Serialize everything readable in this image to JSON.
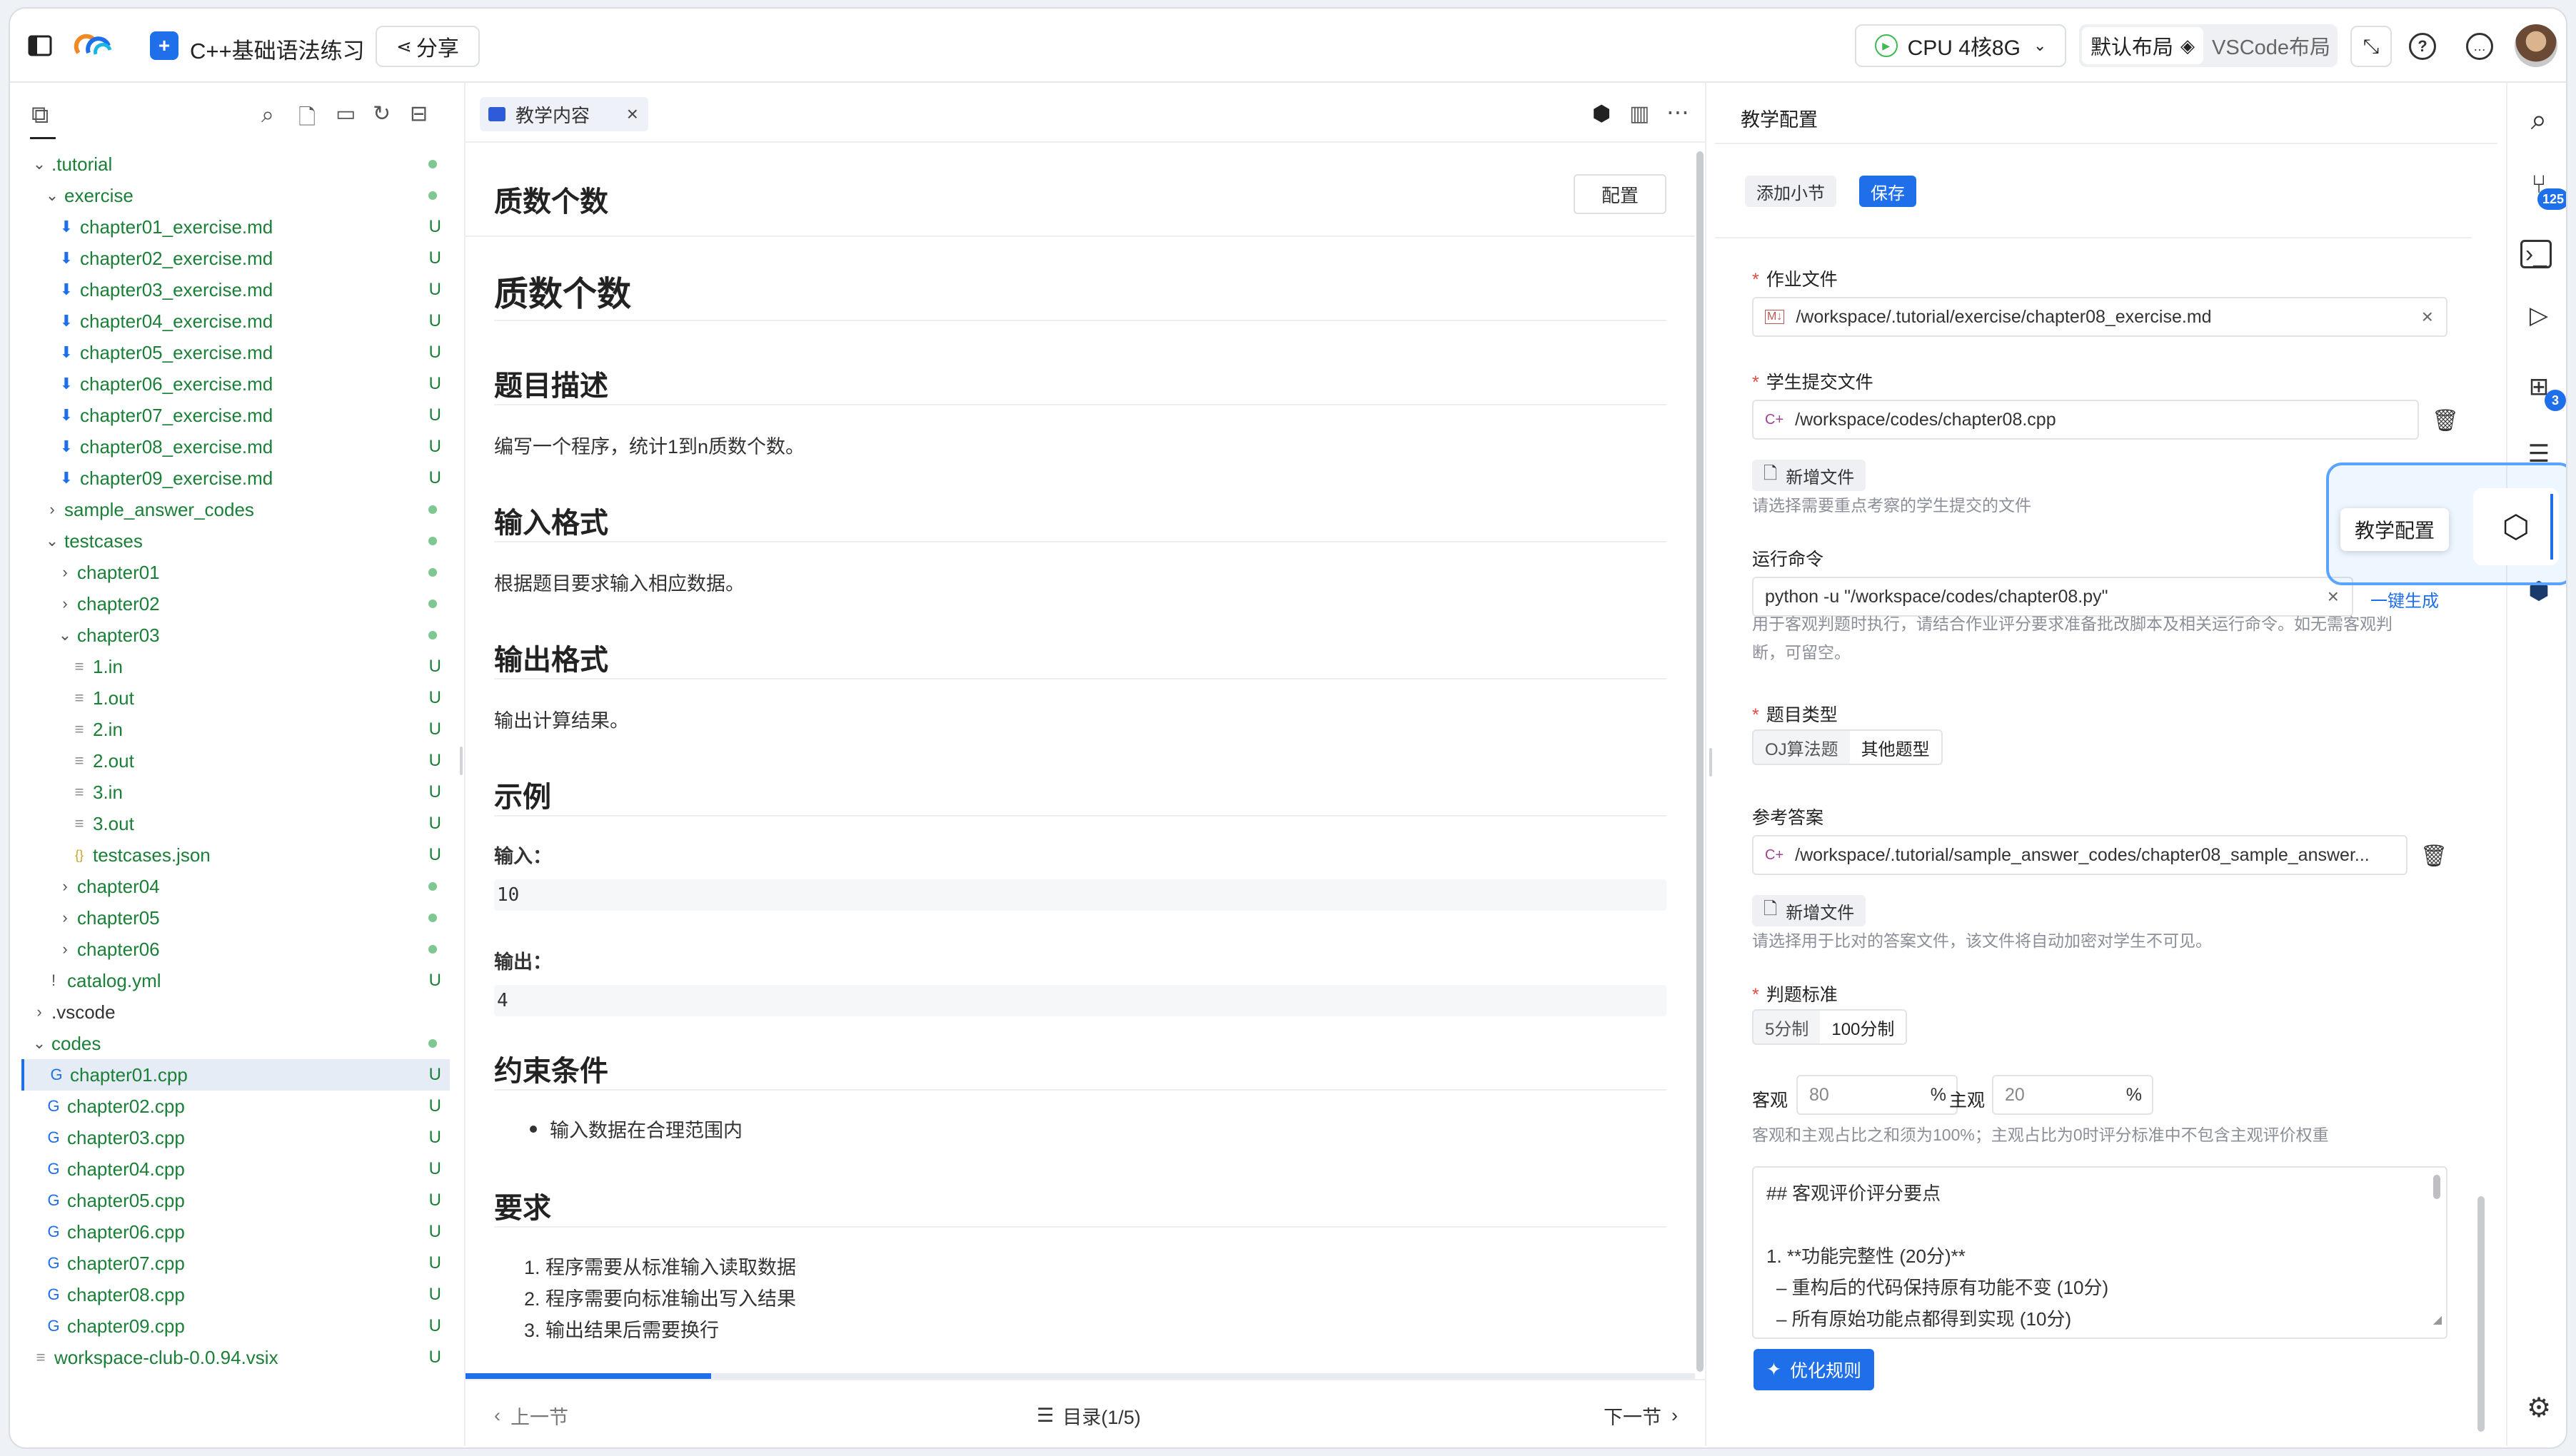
{
  "topbar": {
    "title": "C++基础语法练习",
    "share_label": "分享",
    "cpu_label": "CPU 4核8G",
    "layout_default": "默认布局",
    "layout_vscode": "VSCode布局"
  },
  "explorer": {
    "rows": [
      {
        "label": ".tutorial",
        "status": "dot"
      },
      {
        "label": "exercise",
        "status": "dot"
      },
      {
        "label": "chapter01_exercise.md",
        "status": "U"
      },
      {
        "label": "chapter02_exercise.md",
        "status": "U"
      },
      {
        "label": "chapter03_exercise.md",
        "status": "U"
      },
      {
        "label": "chapter04_exercise.md",
        "status": "U"
      },
      {
        "label": "chapter05_exercise.md",
        "status": "U"
      },
      {
        "label": "chapter06_exercise.md",
        "status": "U"
      },
      {
        "label": "chapter07_exercise.md",
        "status": "U"
      },
      {
        "label": "chapter08_exercise.md",
        "status": "U"
      },
      {
        "label": "chapter09_exercise.md",
        "status": "U"
      },
      {
        "label": "sample_answer_codes",
        "status": "dot"
      },
      {
        "label": "testcases",
        "status": "dot"
      },
      {
        "label": "chapter01",
        "status": "dot"
      },
      {
        "label": "chapter02",
        "status": "dot"
      },
      {
        "label": "chapter03",
        "status": "dot"
      },
      {
        "label": "1.in",
        "status": "U"
      },
      {
        "label": "1.out",
        "status": "U"
      },
      {
        "label": "2.in",
        "status": "U"
      },
      {
        "label": "2.out",
        "status": "U"
      },
      {
        "label": "3.in",
        "status": "U"
      },
      {
        "label": "3.out",
        "status": "U"
      },
      {
        "label": "testcases.json",
        "status": "U"
      },
      {
        "label": "chapter04",
        "status": "dot"
      },
      {
        "label": "chapter05",
        "status": "dot"
      },
      {
        "label": "chapter06",
        "status": "dot"
      },
      {
        "label": "catalog.yml",
        "status": "U"
      },
      {
        "label": ".vscode",
        "status": ""
      },
      {
        "label": "codes",
        "status": "dot"
      },
      {
        "label": "chapter01.cpp",
        "status": "U"
      },
      {
        "label": "chapter02.cpp",
        "status": "U"
      },
      {
        "label": "chapter03.cpp",
        "status": "U"
      },
      {
        "label": "chapter04.cpp",
        "status": "U"
      },
      {
        "label": "chapter05.cpp",
        "status": "U"
      },
      {
        "label": "chapter06.cpp",
        "status": "U"
      },
      {
        "label": "chapter07.cpp",
        "status": "U"
      },
      {
        "label": "chapter08.cpp",
        "status": "U"
      },
      {
        "label": "chapter09.cpp",
        "status": "U"
      },
      {
        "label": "workspace-club-0.0.94.vsix",
        "status": "U"
      }
    ]
  },
  "editor": {
    "tab_label": "教学内容",
    "page_title": "质数个数",
    "config_button": "配置",
    "heading": "质数个数",
    "sec_desc": "题目描述",
    "desc_text": "编写一个程序，统计1到n质数个数。",
    "sec_input": "输入格式",
    "input_text": "根据题目要求输入相应数据。",
    "sec_output": "输出格式",
    "output_text": "输出计算结果。",
    "sec_example": "示例",
    "example_input_label": "输入：",
    "example_input": "10",
    "example_output_label": "输出：",
    "example_output": "4",
    "sec_constraints": "约束条件",
    "constraint_1": "输入数据在合理范围内",
    "sec_requirements": "要求",
    "req_1": "1. 程序需要从标准输入读取数据",
    "req_2": "2. 程序需要向标准输出写入结果",
    "req_3": "3. 输出结果后需要换行",
    "progress": 0.2,
    "prev_label": "上一节",
    "toc_label": "目录(1/5)",
    "next_label": "下一节"
  },
  "config": {
    "panel_title": "教学配置",
    "add_section": "添加小节",
    "save": "保存",
    "homework_label": "作业文件",
    "homework_value": "/workspace/.tutorial/exercise/chapter08_exercise.md",
    "student_label": "学生提交文件",
    "student_value": "/workspace/codes/chapter08.cpp",
    "add_file": "新增文件",
    "student_hint": "请选择需要重点考察的学生提交的文件",
    "run_label": "运行命令",
    "run_value": "python -u \"/workspace/codes/chapter08.py\"",
    "auto_gen": "一键生成",
    "run_hint_1": "用于客观判题时执行，请结合作业评分要求准备批改脚本及相关运行命令。如无需客观判",
    "run_hint_2": "断，可留空。",
    "type_label": "题目类型",
    "type_oj": "OJ算法题",
    "type_other": "其他题型",
    "answer_label": "参考答案",
    "answer_value": "/workspace/.tutorial/sample_answer_codes/chapter08_sample_answer...",
    "answer_hint": "请选择用于比对的答案文件，该文件将自动加密对学生不可见。",
    "criteria_label": "判题标准",
    "scale_5": "5分制",
    "scale_100": "100分制",
    "objective_label": "客观",
    "objective_value": "80",
    "subjective_label": "主观",
    "subjective_value": "20",
    "percent": "%",
    "ratio_hint": "客观和主观占比之和须为100%；主观占比为0时评分标准中不包含主观评价权重",
    "rubric_1": "## 客观评价评分要点",
    "rubric_2": "1. **功能完整性 (20分)**",
    "rubric_3": "   – 重构后的代码保持原有功能不变 (10分)",
    "rubric_4": "   – 所有原始功能点都得到实现 (10分)",
    "optimize": "优化规则",
    "tooltip": "教学配置"
  },
  "activity": {
    "git_badge": "125",
    "ext_badge": "3"
  }
}
